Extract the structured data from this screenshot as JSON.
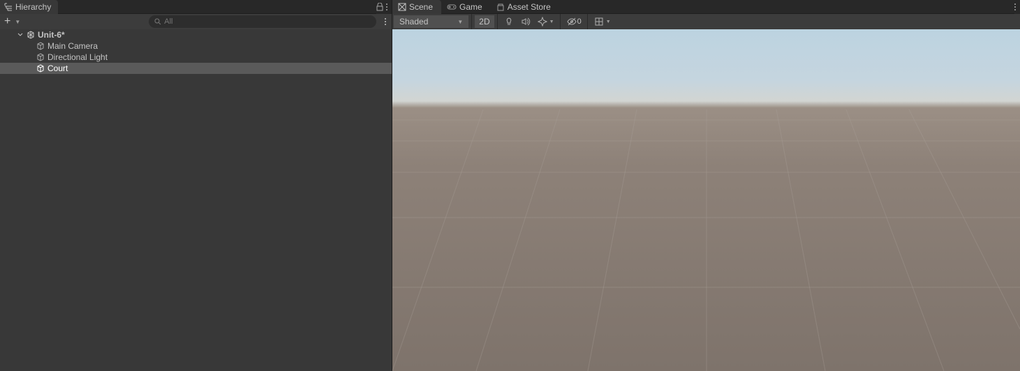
{
  "hierarchy": {
    "tab_label": "Hierarchy",
    "search_placeholder": "All",
    "scene_name": "Unit-6*",
    "items": [
      {
        "name": "Main Camera"
      },
      {
        "name": "Directional Light"
      },
      {
        "name": "Court",
        "selected": true
      }
    ]
  },
  "scene": {
    "tabs": [
      {
        "label": "Scene",
        "icon": "scene-icon",
        "active": true
      },
      {
        "label": "Game",
        "icon": "game-icon",
        "active": false
      },
      {
        "label": "Asset Store",
        "icon": "store-icon",
        "active": false
      }
    ],
    "shading_mode": "Shaded",
    "two_d_label": "2D",
    "hidden_count": "0"
  }
}
